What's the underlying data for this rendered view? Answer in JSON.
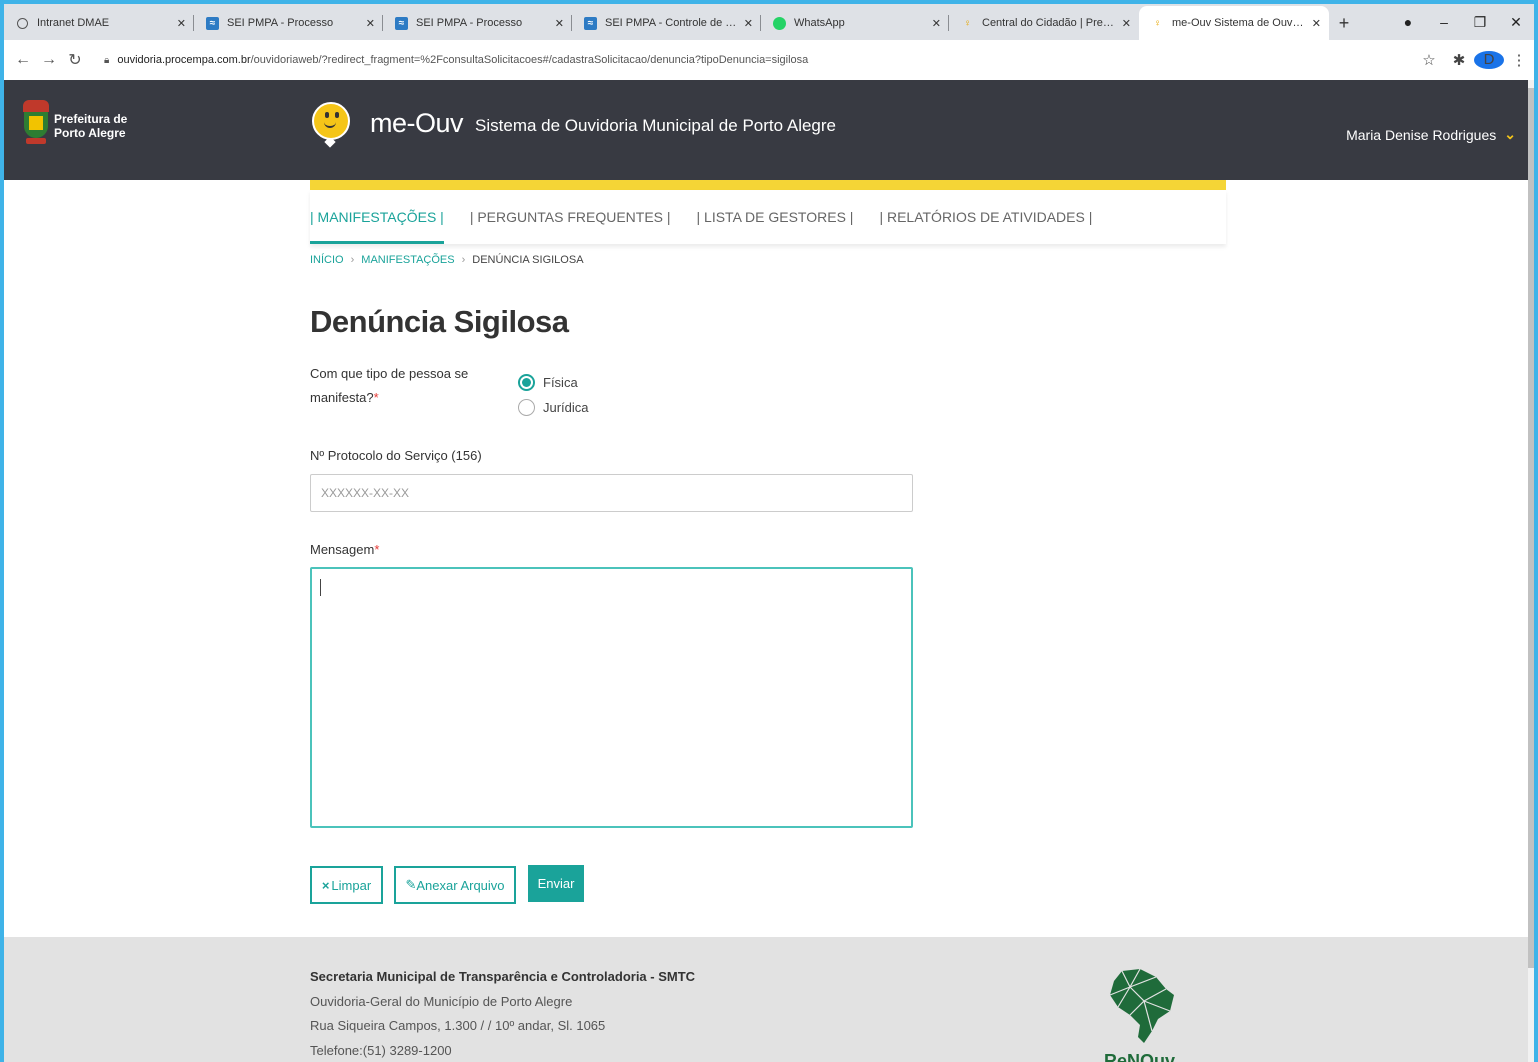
{
  "browser": {
    "tabs": [
      {
        "title": "Intranet DMAE",
        "icon": "globe-icon"
      },
      {
        "title": "SEI PMPA - Processo",
        "icon": "sei-icon"
      },
      {
        "title": "SEI PMPA - Processo",
        "icon": "sei-icon"
      },
      {
        "title": "SEI PMPA - Controle de Process",
        "icon": "sei-icon"
      },
      {
        "title": "WhatsApp",
        "icon": "whatsapp-icon"
      },
      {
        "title": "Central do Cidadão | Prefeitura d",
        "icon": "bulb-icon"
      },
      {
        "title": "me-Ouv   Sistema de Ouvidor",
        "icon": "bulb-icon",
        "active": true
      }
    ],
    "url_host": "ouvidoria.procempa.com.br",
    "url_path": "/ouvidoriaweb/?redirect_fragment=%2FconsultaSolicitacoes#/cadastraSolicitacao/denuncia?tipoDenuncia=sigilosa",
    "profile_initial": "D"
  },
  "header": {
    "pmpa_line1": "Prefeitura de",
    "pmpa_line2": "Porto Alegre",
    "brand": "me-Ouv",
    "subtitle": "Sistema de Ouvidoria Municipal de Porto Alegre",
    "user_name": "Maria Denise Rodrigues"
  },
  "nav": {
    "items": [
      {
        "label": "| MANIFESTAÇÕES |",
        "active": true
      },
      {
        "label": "| PERGUNTAS FREQUENTES |"
      },
      {
        "label": "| LISTA DE GESTORES |"
      },
      {
        "label": "| RELATÓRIOS DE ATIVIDADES |"
      }
    ]
  },
  "breadcrumb": {
    "home": "INÍCIO",
    "section": "MANIFESTAÇÕES",
    "current": "DENÚNCIA SIGILOSA",
    "separator": "›"
  },
  "form": {
    "title": "Denúncia Sigilosa",
    "person_type_label_line1": "Com que tipo de pessoa se",
    "person_type_label_line2": "manifesta?",
    "required_mark": "*",
    "person_options": [
      {
        "label": "Física",
        "checked": true
      },
      {
        "label": "Jurídica",
        "checked": false
      }
    ],
    "protocol_label": "Nº Protocolo do Serviço (156)",
    "protocol_placeholder": "XXXXXX-XX-XX",
    "message_label": "Mensagem",
    "message_value": "",
    "buttons": {
      "clear": "Limpar",
      "clear_icon": "×",
      "attach": "Anexar Arquivo",
      "attach_icon": "✎",
      "send": "Enviar"
    }
  },
  "footer": {
    "line1": "Secretaria Municipal de Transparência e Controladoria - SMTC",
    "line2": "Ouvidoria-Geral do Município de Porto Alegre",
    "line3": "Rua Siqueira Campos, 1.300 / / 10º andar, Sl. 1065",
    "line4": "Telefone:(51) 3289-1200",
    "logo_text": "ReNOuv"
  },
  "colors": {
    "accent": "#1aa39a",
    "header_bg": "#383a42",
    "yellow": "#f5d536",
    "required": "#e53935"
  }
}
